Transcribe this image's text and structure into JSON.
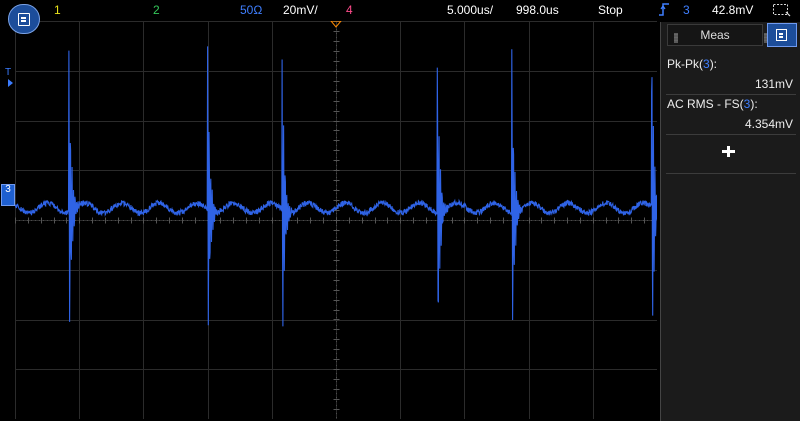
{
  "topbar": {
    "ch1_label": "1",
    "ch2_label": "2",
    "impedance": "50Ω",
    "volts_per_div": "20mV/",
    "ch4_label": "4",
    "time_per_div": "5.000us/",
    "time_delay": "998.0us",
    "run_state": "Stop",
    "trigger_source": "3",
    "trigger_level": "42.8mV"
  },
  "icons": {
    "menu": "main-menu-icon",
    "trigger_edge": "rising-edge-icon",
    "select": "selection-box-icon",
    "add": "plus-icon"
  },
  "markers": {
    "trigger_marker": "T",
    "ch3_marker": "3"
  },
  "panel": {
    "tab_label": "Meas",
    "measurements": [
      {
        "name_prefix": "Pk-Pk(",
        "channel": "3",
        "name_suffix": "):",
        "value": "131mV"
      },
      {
        "name_prefix": "AC RMS - FS(",
        "channel": "3",
        "name_suffix": "):",
        "value": "4.354mV"
      }
    ]
  },
  "colors": {
    "ch1": "#e8e21a",
    "ch2": "#34c759",
    "ch3": "#3f7fff",
    "ch4": "#ff4b8b",
    "trace": "#2f63e6",
    "accent_button": "#1c4d9a"
  },
  "waveform": {
    "channel": "3",
    "baseline_mV": 0,
    "ripple_mV": 2,
    "spike_times_us": [
      -20.8,
      -10.0,
      -4.2,
      7.9,
      13.7,
      24.6
    ],
    "spike_peak_mV": 66,
    "spike_trough_mV": -65,
    "time_range_us": [
      -25,
      25
    ],
    "volt_range_mV": [
      -80,
      80
    ]
  }
}
